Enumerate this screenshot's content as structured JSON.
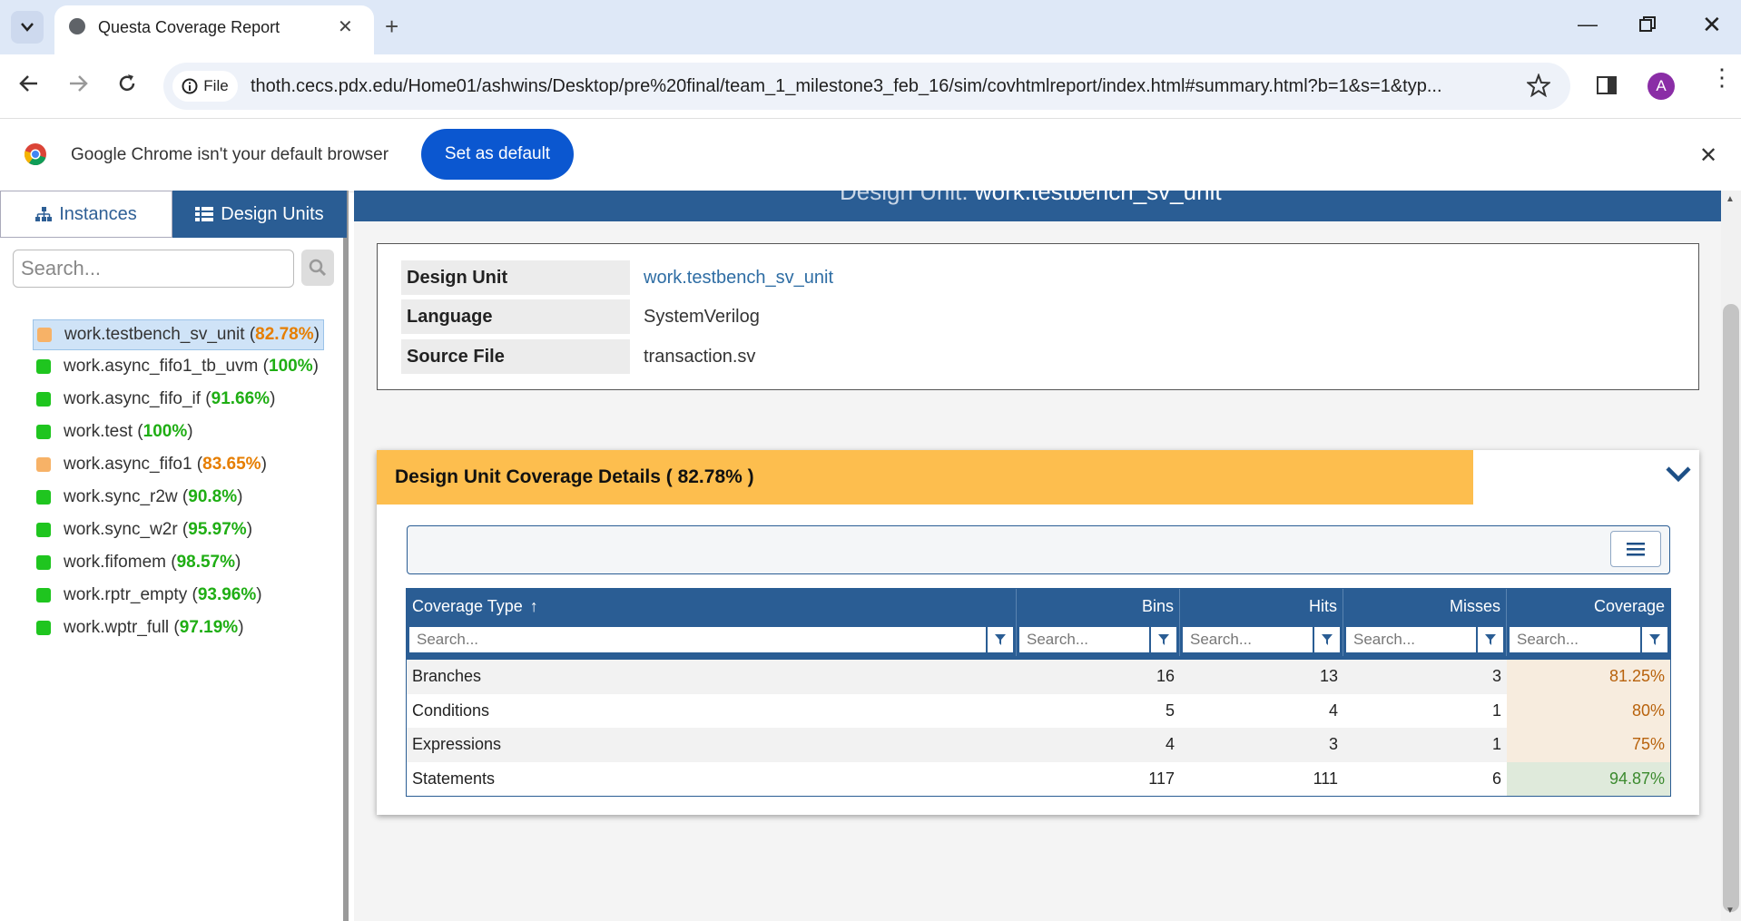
{
  "browser": {
    "tab_title": "Questa Coverage Report",
    "file_chip": "File",
    "url": "thoth.cecs.pdx.edu/Home01/ashwins/Desktop/pre%20final/team_1_milestone3_feb_16/sim/covhtmlreport/index.html#summary.html?b=1&s=1&typ...",
    "profile_initial": "A"
  },
  "infobar": {
    "message": "Google Chrome isn't your default browser",
    "button": "Set as default"
  },
  "sidebar": {
    "tabs": [
      "Instances",
      "Design Units"
    ],
    "search_placeholder": "Search...",
    "items": [
      {
        "name": "work.testbench_sv_unit",
        "pct": "82.78%",
        "status": "partial",
        "color": "#f7b267"
      },
      {
        "name": "work.async_fifo1_tb_uvm",
        "pct": "100%",
        "status": "good",
        "color": "#1fc51f"
      },
      {
        "name": "work.async_fifo_if",
        "pct": "91.66%",
        "status": "good",
        "color": "#1fc51f"
      },
      {
        "name": "work.test",
        "pct": "100%",
        "status": "good",
        "color": "#1fc51f"
      },
      {
        "name": "work.async_fifo1",
        "pct": "83.65%",
        "status": "partial",
        "color": "#f7b267"
      },
      {
        "name": "work.sync_r2w",
        "pct": "90.8%",
        "status": "good",
        "color": "#1fc51f"
      },
      {
        "name": "work.sync_w2r",
        "pct": "95.97%",
        "status": "good",
        "color": "#1fc51f"
      },
      {
        "name": "work.fifomem",
        "pct": "98.57%",
        "status": "good",
        "color": "#1fc51f"
      },
      {
        "name": "work.rptr_empty",
        "pct": "93.96%",
        "status": "good",
        "color": "#1fc51f"
      },
      {
        "name": "work.wptr_full",
        "pct": "97.19%",
        "status": "good",
        "color": "#1fc51f"
      }
    ]
  },
  "banner": {
    "label": "Design Unit:",
    "value": "work.testbench_sv_unit"
  },
  "info": {
    "design_unit_label": "Design Unit",
    "design_unit_value": "work.testbench_sv_unit",
    "language_label": "Language",
    "language_value": "SystemVerilog",
    "source_label": "Source File",
    "source_value": "transaction.sv"
  },
  "coverage": {
    "header": "Design Unit Coverage Details ( 82.78% )",
    "columns": [
      "Coverage Type",
      "Bins",
      "Hits",
      "Misses",
      "Coverage"
    ],
    "sort_indicator": "↑",
    "filter_placeholder": "Search...",
    "rows": [
      {
        "type": "Branches",
        "bins": "16",
        "hits": "13",
        "misses": "3",
        "coverage": "81.25%",
        "status": "partial"
      },
      {
        "type": "Conditions",
        "bins": "5",
        "hits": "4",
        "misses": "1",
        "coverage": "80%",
        "status": "partial"
      },
      {
        "type": "Expressions",
        "bins": "4",
        "hits": "3",
        "misses": "1",
        "coverage": "75%",
        "status": "partial"
      },
      {
        "type": "Statements",
        "bins": "117",
        "hits": "111",
        "misses": "6",
        "coverage": "94.87%",
        "status": "good"
      }
    ]
  },
  "colors": {
    "brand_blue": "#2a5d94",
    "header_orange": "#fdbe4e",
    "partial_text": "#b8620c",
    "good_text": "#3b8a2e"
  }
}
